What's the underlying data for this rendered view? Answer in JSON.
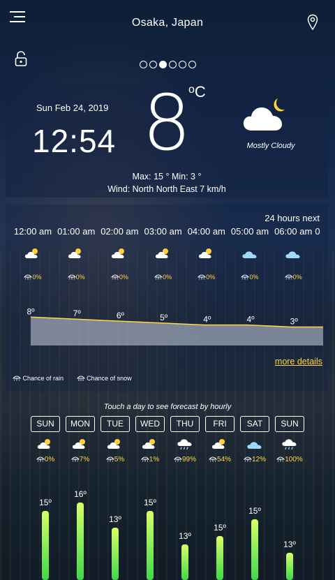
{
  "header": {
    "city": "Osaka, Japan",
    "menu_icon": "hamburger-menu-icon",
    "location_icon": "map-pin-icon",
    "lock_icon": "unlock-icon"
  },
  "pager": {
    "count": 6,
    "active": 2
  },
  "current": {
    "date": "Sun Feb 24, 2019",
    "time": "12:54",
    "temperature": "8",
    "unit": "oC",
    "condition": "Mostly Cloudy",
    "condition_icon": "cloud-moon-icon",
    "maxmin": "Max: 15 °  Min: 3 °",
    "wind": "Wind: North North East 7 km/h"
  },
  "hourly": {
    "header": "24 hours next",
    "items": [
      {
        "time": "12:00 am",
        "icon": "cloud-sun-icon",
        "rain": "0%",
        "temp": "8º",
        "temp_value": 8
      },
      {
        "time": "01:00 am",
        "icon": "cloud-sun-icon",
        "rain": "0%",
        "temp": "7º",
        "temp_value": 7
      },
      {
        "time": "02:00 am",
        "icon": "cloud-sun-icon",
        "rain": "0%",
        "temp": "6º",
        "temp_value": 6
      },
      {
        "time": "03:00 am",
        "icon": "cloud-sun-icon",
        "rain": "0%",
        "temp": "5º",
        "temp_value": 5
      },
      {
        "time": "04:00 am",
        "icon": "cloud-sun-icon",
        "rain": "0%",
        "temp": "4º",
        "temp_value": 4
      },
      {
        "time": "05:00 am",
        "icon": "cloud-icon",
        "rain": "0%",
        "temp": "4º",
        "temp_value": 4
      },
      {
        "time": "06:00 am",
        "icon": "cloud-icon",
        "rain": "0%",
        "temp": "3º",
        "temp_value": 3
      },
      {
        "time": "0",
        "icon": "",
        "rain": "",
        "temp": "",
        "temp_value": 3
      }
    ],
    "more_details": "more details",
    "legend_rain": "Chance of rain",
    "legend_snow": "Chance of snow"
  },
  "daily": {
    "hint": "Touch a day to see forecast by hourly",
    "items": [
      {
        "day": "SUN",
        "icon": "cloud-sun-icon",
        "rain": "0%",
        "temp": "15º",
        "temp_value": 15
      },
      {
        "day": "MON",
        "icon": "cloud-sun-icon",
        "rain": "7%",
        "temp": "16º",
        "temp_value": 16
      },
      {
        "day": "TUE",
        "icon": "cloud-sun-icon",
        "rain": "5%",
        "temp": "13º",
        "temp_value": 13
      },
      {
        "day": "WED",
        "icon": "cloud-sun-icon",
        "rain": "1%",
        "temp": "15º",
        "temp_value": 15
      },
      {
        "day": "THU",
        "icon": "cloud-rain-icon",
        "rain": "99%",
        "temp": "13º",
        "temp_value": 13
      },
      {
        "day": "FRI",
        "icon": "cloud-sun-icon",
        "rain": "54%",
        "temp": "15º",
        "temp_value": 15
      },
      {
        "day": "SAT",
        "icon": "cloud-icon",
        "rain": "12%",
        "temp": "15º",
        "temp_value": 15
      },
      {
        "day": "SUN",
        "icon": "cloud-rain-icon",
        "rain": "100%",
        "temp": "13º",
        "temp_value": 13
      }
    ]
  },
  "colors": {
    "accent": "#ffd840",
    "bar_top": "#d8ff6a",
    "bar_bottom": "#3fd84a"
  }
}
